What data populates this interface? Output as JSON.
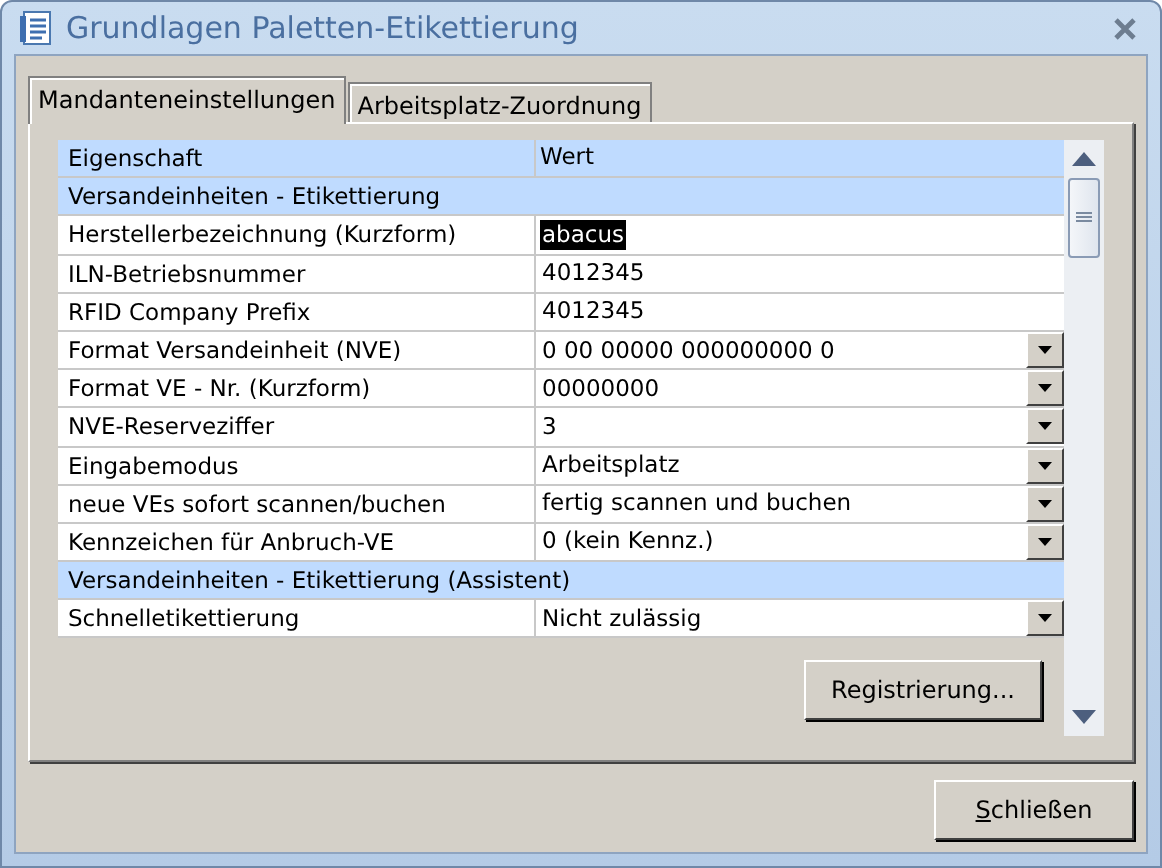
{
  "window": {
    "title": "Grundlagen Paletten-Etikettierung"
  },
  "tabs": [
    {
      "label": "Mandanteneinstellungen",
      "selected": true
    },
    {
      "label": "Arbeitsplatz-Zuordnung",
      "selected": false
    }
  ],
  "grid": {
    "columns": [
      "Eigenschaft",
      "Wert"
    ],
    "rows": [
      {
        "kind": "section",
        "label": "Versandeinheiten - Etikettierung"
      },
      {
        "kind": "property",
        "label": "Herstellerbezeichnung (Kurzform)",
        "value": "abacus",
        "selected": true,
        "dropdown": false
      },
      {
        "kind": "property",
        "label": "ILN-Betriebsnummer",
        "value": "4012345",
        "selected": false,
        "dropdown": false
      },
      {
        "kind": "property",
        "label": "RFID Company Prefix",
        "value": "4012345",
        "selected": false,
        "dropdown": false
      },
      {
        "kind": "property",
        "label": "Format Versandeinheit (NVE)",
        "value": "0 00 00000 000000000 0",
        "selected": false,
        "dropdown": true
      },
      {
        "kind": "property",
        "label": "Format VE - Nr. (Kurzform)",
        "value": "00000000",
        "selected": false,
        "dropdown": true
      },
      {
        "kind": "property",
        "label": "NVE-Reserveziffer",
        "value": "3",
        "selected": false,
        "dropdown": true
      },
      {
        "kind": "property",
        "label": "Eingabemodus",
        "value": "Arbeitsplatz",
        "selected": false,
        "dropdown": true
      },
      {
        "kind": "property",
        "label": "neue VEs sofort scannen/buchen",
        "value": "fertig scannen und buchen",
        "selected": false,
        "dropdown": true
      },
      {
        "kind": "property",
        "label": "Kennzeichen für Anbruch-VE",
        "value": "0 (kein Kennz.)",
        "selected": false,
        "dropdown": true
      },
      {
        "kind": "section",
        "label": "Versandeinheiten - Etikettierung (Assistent)"
      },
      {
        "kind": "property",
        "label": "Schnelletikettierung",
        "value": "Nicht zulässig",
        "selected": false,
        "dropdown": true
      }
    ]
  },
  "register_button": {
    "label": "Registrierung..."
  },
  "close_button": {
    "label": "Schließen"
  }
}
